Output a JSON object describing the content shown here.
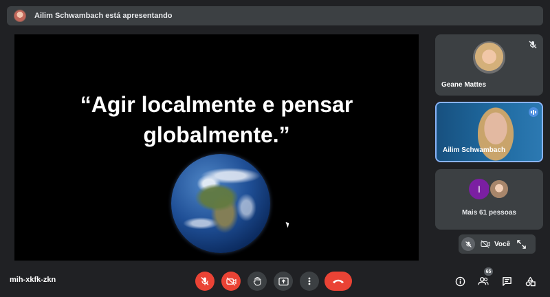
{
  "presenter_banner": {
    "text": "Ailim Schwambach está apresentando",
    "avatar_icon": "presenter-avatar"
  },
  "presentation": {
    "quote": "“Agir localmente e pensar globalmente.”"
  },
  "participants": [
    {
      "name": "Geane Mattes",
      "muted": true
    },
    {
      "name": "Ailim Schwambach",
      "speaking": true
    }
  ],
  "more_people": {
    "initial": "I",
    "label": "Mais 61 pessoas"
  },
  "self_view": {
    "label": "Você"
  },
  "bottom_bar": {
    "meeting_code": "mih-xkfk-zkn",
    "people_count": "65"
  },
  "colors": {
    "background": "#202124",
    "panel": "#3c4043",
    "danger": "#ea4335",
    "accent": "#8ab4f8",
    "more_avatar": "#7b1fa2"
  }
}
